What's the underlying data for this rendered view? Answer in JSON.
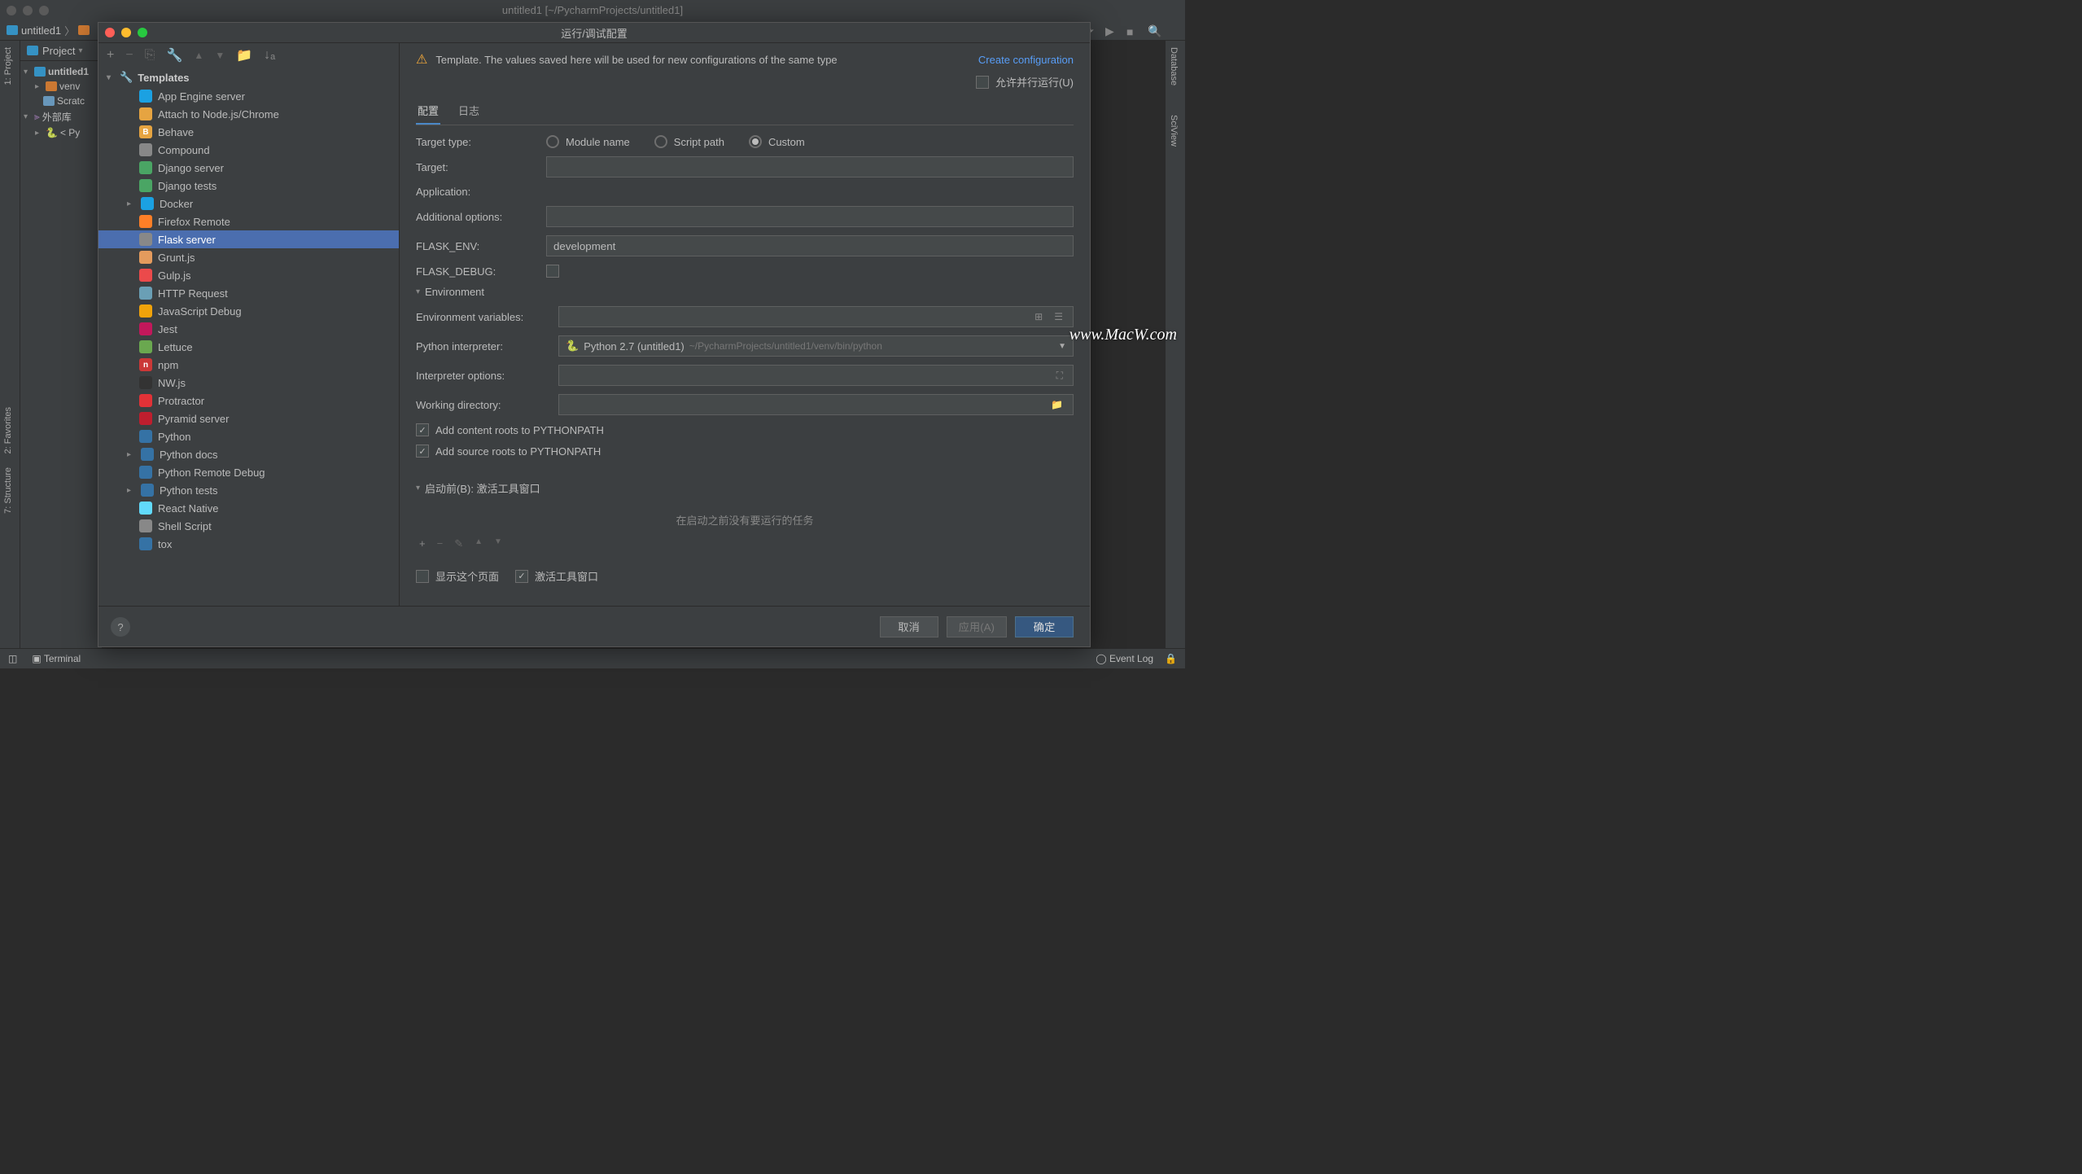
{
  "window": {
    "title": "untitled1 [~/PycharmProjects/untitled1]",
    "breadcrumb": "untitled1"
  },
  "projectPanel": {
    "title": "Project",
    "root": "untitled1",
    "children": [
      "venv",
      "Scratc"
    ],
    "external": "外部库",
    "pyNode": "< Py"
  },
  "leftBar": {
    "project": "1: Project",
    "favorites": "2: Favorites",
    "structure": "7: Structure"
  },
  "rightBar": {
    "database": "Database",
    "sciview": "SciView"
  },
  "bottom": {
    "terminal": "Terminal",
    "eventlog": "Event Log"
  },
  "dialog": {
    "title": "运行/调试配置",
    "notice": "Template. The values saved here will be used for new configurations of the same type",
    "createLink": "Create configuration",
    "allowParallel": "允许并行运行(U)",
    "tabs": {
      "config": "配置",
      "logs": "日志"
    },
    "templatesHeader": "Templates",
    "templates": [
      {
        "label": "App Engine server",
        "color": "#1ba1e2"
      },
      {
        "label": "Attach to Node.js/Chrome",
        "color": "#e6a441"
      },
      {
        "label": "Behave",
        "color": "#e6a441",
        "text": "B"
      },
      {
        "label": "Compound",
        "color": "#888"
      },
      {
        "label": "Django server",
        "color": "#4aa564"
      },
      {
        "label": "Django tests",
        "color": "#4aa564"
      },
      {
        "label": "Docker",
        "color": "#1ba1e2",
        "arrow": true
      },
      {
        "label": "Firefox Remote",
        "color": "#ff7f27"
      },
      {
        "label": "Flask server",
        "color": "#888",
        "selected": true
      },
      {
        "label": "Grunt.js",
        "color": "#e49b5d"
      },
      {
        "label": "Gulp.js",
        "color": "#eb4a4b"
      },
      {
        "label": "HTTP Request",
        "color": "#6a9fb5"
      },
      {
        "label": "JavaScript Debug",
        "color": "#f0a30a"
      },
      {
        "label": "Jest",
        "color": "#c2185b"
      },
      {
        "label": "Lettuce",
        "color": "#6aa84f"
      },
      {
        "label": "npm",
        "color": "#cb3837",
        "text": "n"
      },
      {
        "label": "NW.js",
        "color": "#333"
      },
      {
        "label": "Protractor",
        "color": "#e23237"
      },
      {
        "label": "Pyramid server",
        "color": "#bf1e2e"
      },
      {
        "label": "Python",
        "color": "#3572A5"
      },
      {
        "label": "Python docs",
        "color": "#3572A5",
        "arrow": true
      },
      {
        "label": "Python Remote Debug",
        "color": "#3572A5"
      },
      {
        "label": "Python tests",
        "color": "#3572A5",
        "arrow": true
      },
      {
        "label": "React Native",
        "color": "#61dafb"
      },
      {
        "label": "Shell Script",
        "color": "#888"
      },
      {
        "label": "tox",
        "color": "#3572A5"
      }
    ],
    "form": {
      "targetType": "Target type:",
      "radios": {
        "module": "Module name",
        "script": "Script path",
        "custom": "Custom"
      },
      "target": "Target:",
      "application": "Application:",
      "additionalOpts": "Additional options:",
      "flaskEnv": "FLASK_ENV:",
      "flaskEnvValue": "development",
      "flaskDebug": "FLASK_DEBUG:",
      "envSection": "Environment",
      "envVars": "Environment variables:",
      "pyInterp": "Python interpreter:",
      "pyInterpValue": "Python 2.7 (untitled1)",
      "pyInterpPath": "~/PycharmProjects/untitled1/venv/bin/python",
      "interpOpts": "Interpreter options:",
      "workDir": "Working directory:",
      "addContent": "Add content roots to PYTHONPATH",
      "addSource": "Add source roots to PYTHONPATH",
      "beforeLaunch": "启动前(B): 激活工具窗口",
      "noTasks": "在启动之前没有要运行的任务",
      "showPage": "显示这个页面",
      "activateWindow": "激活工具窗口"
    },
    "buttons": {
      "cancel": "取消",
      "apply": "应用(A)",
      "ok": "确定"
    }
  },
  "watermark": "www.MacW.com"
}
